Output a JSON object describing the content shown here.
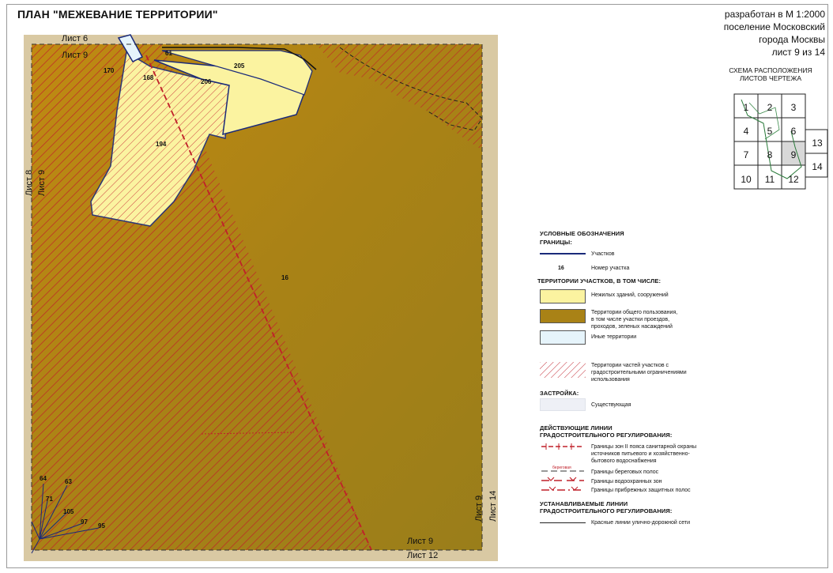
{
  "title": "ПЛАН \"МЕЖЕВАНИЕ ТЕРРИТОРИИ\"",
  "header": {
    "line1": "разработан в М 1:2000",
    "line2": "поселение Московский",
    "line3": "города Москвы",
    "sheet": "лист 9 из 14"
  },
  "scheme": {
    "title_line1": "СХЕМА РАСПОЛОЖЕНИЯ",
    "title_line2": "ЛИСТОВ ЧЕРТЕЖА",
    "cells": [
      "1",
      "2",
      "3",
      "4",
      "5",
      "6",
      "7",
      "8",
      "9",
      "10",
      "11",
      "12",
      "13",
      "14"
    ],
    "current": "9"
  },
  "map": {
    "sheet_labels": {
      "top_a": "Лист 6",
      "top_b": "Лист 9",
      "left_a": "Лист 8",
      "left_b": "Лист 9",
      "right_a": "Лист 9",
      "right_b": "Лист 14",
      "bottom_a": "Лист 9",
      "bottom_b": "Лист 12"
    },
    "parcels": {
      "p61": "61",
      "p170": "170",
      "p168": "168",
      "p206": "206",
      "p205": "205",
      "p194": "194",
      "p16": "16",
      "p64": "64",
      "p63": "63",
      "p71": "71",
      "p105": "105",
      "p97": "97",
      "p95": "95"
    },
    "colors": {
      "common_use": "#b8860b",
      "non_residential": "#fbf3a0",
      "other": "#e6f4fb",
      "boundary": "#1a2a7a",
      "restriction": "#c0202a"
    }
  },
  "legend": {
    "title": "УСЛОВНЫЕ ОБОЗНАЧЕНИЯ",
    "boundaries_head": "ГРАНИЦЫ:",
    "b_parcels": "Участков",
    "b_number_sample": "16",
    "b_number": "Номер участка",
    "territories_head": "ТЕРРИТОРИИ УЧАСТКОВ, В ТОМ ЧИСЛЕ:",
    "t_nonres": "Нежилых зданий, сооружений",
    "t_common_1": "Территории общего пользования,",
    "t_common_2": "в том числе участки проездов,",
    "t_common_3": "проходов, зеленых насаждений",
    "t_other": "Иные территории",
    "t_restr_1": "Территории частей участков с",
    "t_restr_2": "градостроительными ограничениями",
    "t_restr_3": "использования",
    "build_head": "ЗАСТРОЙКА:",
    "build_existing": "Существующая",
    "lines_head_1": "ДЕЙСТВУЮЩИЕ ЛИНИИ",
    "lines_head_2": "ГРАДОСТРОИТЕЛЬНОГО РЕГУЛИРОВАНИЯ:",
    "l_sanitary_1": "Границы зон II пояса санитарной охраны",
    "l_sanitary_2": "источников питьевого и хозяйственно-",
    "l_sanitary_3": "бытового водоснабжения",
    "l_shore_tag": "береговая",
    "l_shore": "Границы береговых полос",
    "l_water": "Границы водоохранных зон",
    "l_coastal": "Границы прибрежных защитных полос",
    "new_head_1": "УСТАНАВЛИВАЕМЫЕ ЛИНИИ",
    "new_head_2": "ГРАДОСТРОИТЕЛЬНОГО РЕГУЛИРОВАНИЯ:",
    "n_red": "Красные линии улично-дорожной сети"
  }
}
